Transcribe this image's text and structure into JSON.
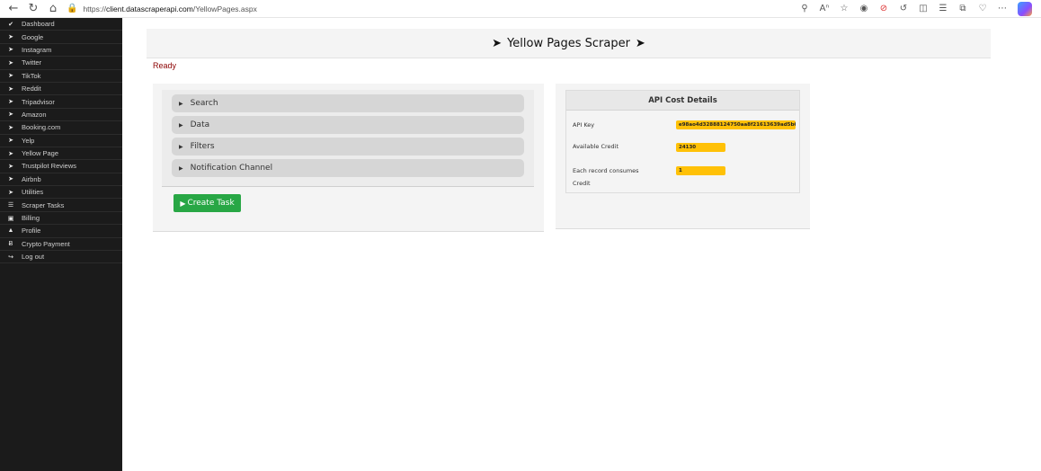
{
  "browser": {
    "url_prefix": "https://",
    "url_host": "client.datascraperapi.com",
    "url_path": "/YellowPages.aspx",
    "icons": [
      "back-icon",
      "refresh-icon",
      "home-icon",
      "lock-icon",
      "zoom-icon",
      "read-aloud-icon",
      "favorite-icon",
      "extension-icon",
      "block-icon",
      "sync-icon",
      "split-screen-icon",
      "favorites-list-icon",
      "collections-icon",
      "browser-essentials-icon",
      "more-icon",
      "copilot-icon"
    ]
  },
  "sidebar": {
    "items": [
      {
        "label": "Dashboard",
        "icon": "check-icon"
      },
      {
        "label": "Google",
        "icon": "paper-plane-icon"
      },
      {
        "label": "Instagram",
        "icon": "paper-plane-icon"
      },
      {
        "label": "Twitter",
        "icon": "paper-plane-icon"
      },
      {
        "label": "TikTok",
        "icon": "paper-plane-icon"
      },
      {
        "label": "Reddit",
        "icon": "paper-plane-icon"
      },
      {
        "label": "Tripadvisor",
        "icon": "paper-plane-icon"
      },
      {
        "label": "Amazon",
        "icon": "paper-plane-icon"
      },
      {
        "label": "Booking.com",
        "icon": "paper-plane-icon"
      },
      {
        "label": "Yelp",
        "icon": "paper-plane-icon"
      },
      {
        "label": "Yellow Page",
        "icon": "paper-plane-icon"
      },
      {
        "label": "Trustpilot Reviews",
        "icon": "paper-plane-icon"
      },
      {
        "label": "Airbnb",
        "icon": "paper-plane-icon"
      },
      {
        "label": "Utilities",
        "icon": "paper-plane-icon"
      },
      {
        "label": "Scraper Tasks",
        "icon": "list-icon"
      },
      {
        "label": "Billing",
        "icon": "money-icon"
      },
      {
        "label": "Profile",
        "icon": "user-icon"
      },
      {
        "label": "Crypto Payment",
        "icon": "bitcoin-icon"
      },
      {
        "label": "Log out",
        "icon": "logout-icon"
      }
    ]
  },
  "main": {
    "title": "Yellow Pages Scraper",
    "status": "Ready",
    "accordion": [
      "Search",
      "Data",
      "Filters",
      "Notification Channel"
    ],
    "create_button": "Create Task"
  },
  "api": {
    "header": "API Cost Details",
    "key_label": "API Key",
    "key_value": "e98ao4d32888124750aa8f21613639ad5b6",
    "credit_label": "Available Credit",
    "credit_value": "24130",
    "consume_label": "Each record consumes Credit",
    "consume_value": "1"
  },
  "colors": {
    "sidebar_bg": "#1b1b1b",
    "status_text": "#8b0000",
    "button_green": "#28a745",
    "badge_yellow": "#ffc107"
  }
}
